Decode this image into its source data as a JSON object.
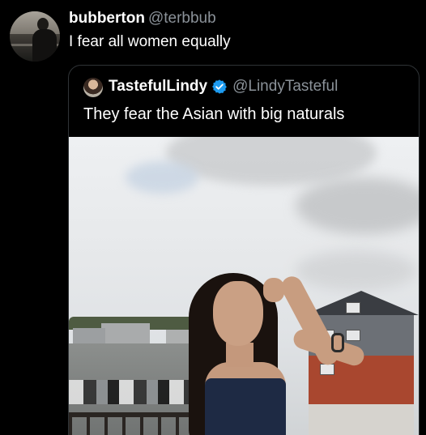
{
  "outer_tweet": {
    "display_name": "bubberton",
    "handle": "@terbbub",
    "text": "I fear all women equally"
  },
  "quoted_tweet": {
    "display_name": "TastefulLindy",
    "verified": true,
    "handle": "@LindyTasteful",
    "text": "They fear the Asian with big naturals"
  },
  "colors": {
    "background": "#000000",
    "name_text": "#ffffff",
    "handle_text": "#8b9299",
    "verified_badge": "#1d9bf0",
    "card_border": "#2f3336"
  },
  "icons": {
    "verified": "verified-badge-icon"
  }
}
